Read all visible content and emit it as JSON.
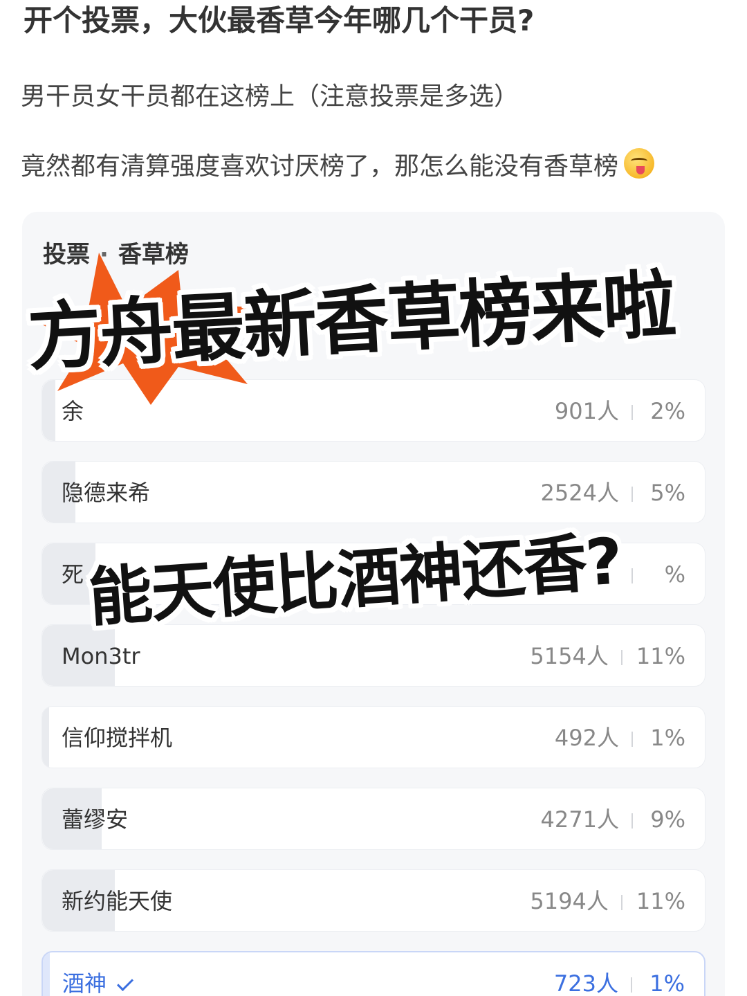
{
  "post": {
    "title": "开个投票，大伙最香草今年哪几个干员?",
    "line1": "男干员女干员都在这榜上（注意投票是多选）",
    "line2": "竟然都有清算强度喜欢讨厌榜了，那怎么能没有香草榜",
    "emoji_icon": "yum-face-emoji"
  },
  "poll": {
    "label": "投票",
    "dot": "·",
    "name": "香草榜",
    "options": [
      {
        "label": "余",
        "votes": "901人",
        "percent": "2%",
        "fraction": 0.02,
        "selected": false
      },
      {
        "label": "隐德来希",
        "votes": "2524人",
        "percent": "5%",
        "fraction": 0.05,
        "selected": false
      },
      {
        "label": "死",
        "votes": "",
        "percent": "%",
        "fraction": 0.08,
        "selected": false
      },
      {
        "label": "Mon3tr",
        "votes": "5154人",
        "percent": "11%",
        "fraction": 0.11,
        "selected": false
      },
      {
        "label": "信仰搅拌机",
        "votes": "492人",
        "percent": "1%",
        "fraction": 0.01,
        "selected": false
      },
      {
        "label": "蕾缪安",
        "votes": "4271人",
        "percent": "9%",
        "fraction": 0.09,
        "selected": false
      },
      {
        "label": "新约能天使",
        "votes": "5194人",
        "percent": "11%",
        "fraction": 0.11,
        "selected": false
      },
      {
        "label": "酒神",
        "votes": "723人",
        "percent": "1%",
        "fraction": 0.01,
        "selected": true
      }
    ]
  },
  "overlay": {
    "headline": "方舟最新香草榜来啦",
    "subline": "能天使比酒神还香?"
  },
  "colors": {
    "accent": "#3b6fe0",
    "burst": "#f05a1a",
    "card_bg": "#f6f7f9"
  }
}
